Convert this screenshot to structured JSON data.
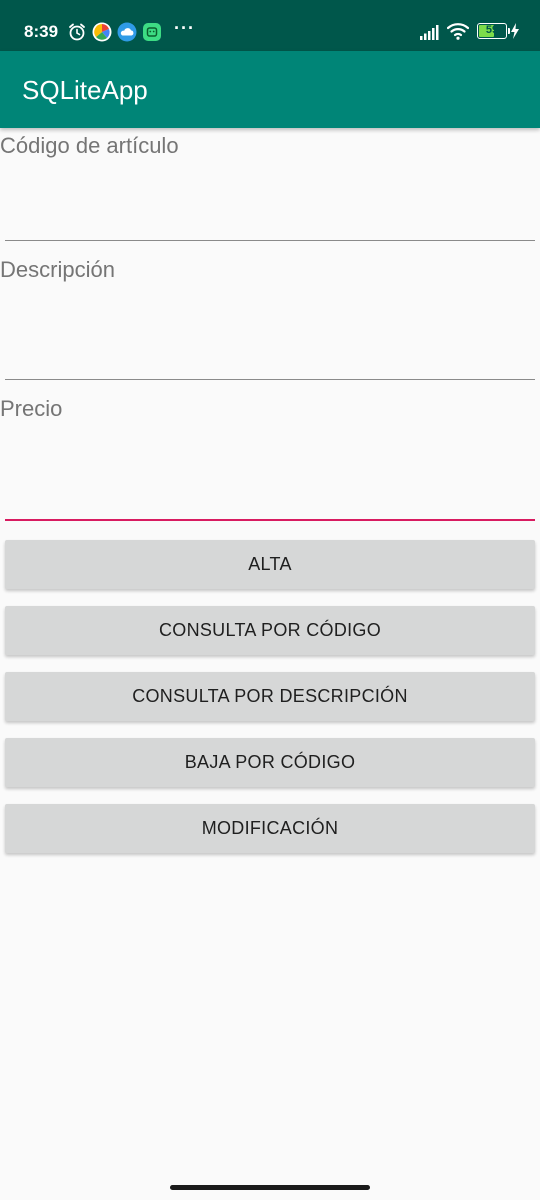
{
  "status_bar": {
    "time": "8:39",
    "icons": [
      "alarm-icon",
      "pinwheel-app-icon",
      "cloud-app-icon",
      "android-app-icon"
    ],
    "overflow": "···",
    "battery_level": "59",
    "battery_fraction": 0.59
  },
  "app_bar": {
    "title": "SQLiteApp"
  },
  "form": {
    "code_label": "Código de artículo",
    "code_value": "",
    "description_label": "Descripción",
    "description_value": "",
    "price_label": "Precio",
    "price_value": ""
  },
  "buttons": {
    "alta": "ALTA",
    "consulta_codigo": "CONSULTA POR CÓDIGO",
    "consulta_descripcion": "CONSULTA POR DESCRIPCIÓN",
    "baja_codigo": "BAJA POR CÓDIGO",
    "modificacion": "MODIFICACIÓN"
  },
  "colors": {
    "status_bar": "#00574b",
    "app_bar": "#008577",
    "accent": "#d81b60",
    "button_bg": "#d6d7d7"
  }
}
